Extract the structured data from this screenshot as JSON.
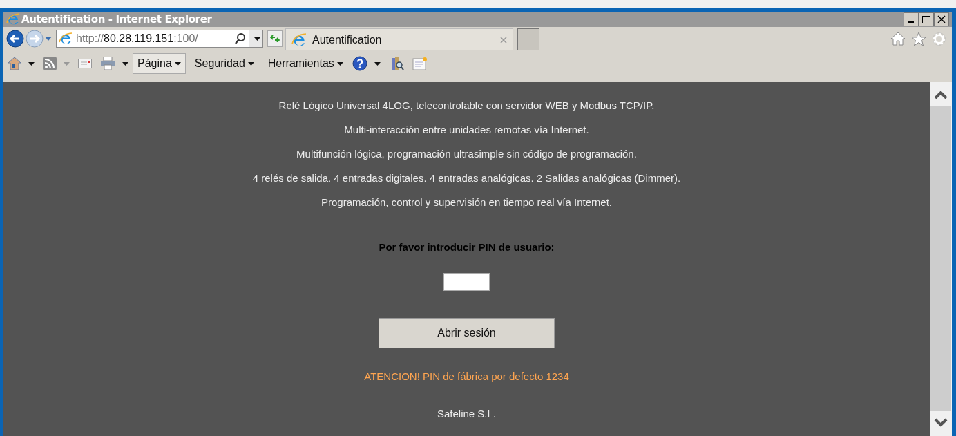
{
  "window": {
    "title": "Autentification - Internet Explorer"
  },
  "address_bar": {
    "url_scheme": "http://",
    "url_host": "80.28.119.151",
    "url_rest": ":100/"
  },
  "tabs": [
    {
      "label": "Autentification",
      "selected": true
    }
  ],
  "command_bar": {
    "menus": [
      {
        "label": "Página",
        "highlighted": true
      },
      {
        "label": "Seguridad",
        "highlighted": false
      },
      {
        "label": "Herramientas",
        "highlighted": false
      }
    ]
  },
  "page": {
    "lines": [
      "Relé Lógico Universal 4LOG, telecontrolable con servidor WEB y Modbus TCP/IP.",
      "Multi-interacción entre unidades remotas vía Internet.",
      "Multifunción lógica, programación ultrasimple sin código de programación.",
      "4 relés de salida. 4 entradas digitales. 4 entradas analógicas. 2 Salidas analógicas (Dimmer).",
      "Programación, control y supervisión en tiempo real vía Internet."
    ],
    "pin_prompt": "Por favor introducir PIN de usuario:",
    "login_button": "Abrir sesión",
    "warning": "ATENCION! PIN de fábrica por defecto 1234",
    "footer": "Safeline S.L."
  }
}
